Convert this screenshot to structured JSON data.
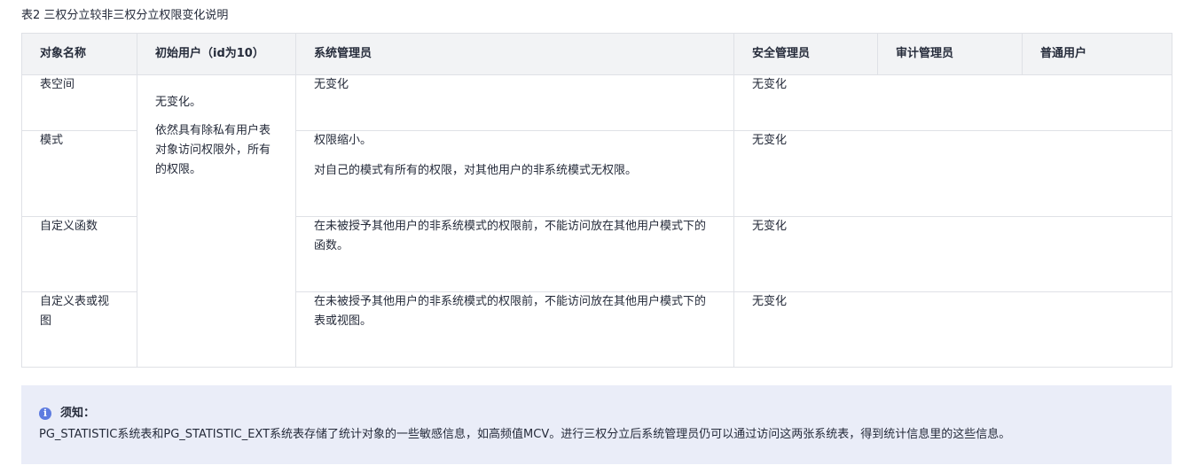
{
  "caption": "表2 三权分立较非三权分立权限变化说明",
  "table": {
    "headers": [
      "对象名称",
      "初始用户（id为10）",
      "系统管理员",
      "安全管理员",
      "审计管理员",
      "普通用户"
    ],
    "merged_initial_user": [
      "无变化。",
      "依然具有除私有用户表对象访问权限外，所有的权限。"
    ],
    "rows": [
      {
        "object": "表空间",
        "sysadmin": [
          "无变化"
        ],
        "others": "无变化"
      },
      {
        "object": "模式",
        "sysadmin": [
          "权限缩小。",
          "对自己的模式有所有的权限，对其他用户的非系统模式无权限。"
        ],
        "others": "无变化"
      },
      {
        "object": "自定义函数",
        "sysadmin": [
          "在未被授予其他用户的非系统模式的权限前，不能访问放在其他用户模式下的函数。"
        ],
        "others": "无变化"
      },
      {
        "object": "自定义表或视图",
        "sysadmin": [
          "在未被授予其他用户的非系统模式的权限前，不能访问放在其他用户模式下的表或视图。"
        ],
        "others": "无变化"
      }
    ]
  },
  "notice": {
    "icon": "info-icon",
    "title": "须知：",
    "body": "PG_STATISTIC系统表和PG_STATISTIC_EXT系统表存储了统计对象的一些敏感信息，如高频值MCV。进行三权分立后系统管理员仍可以通过访问这两张系统表，得到统计信息里的这些信息。"
  }
}
